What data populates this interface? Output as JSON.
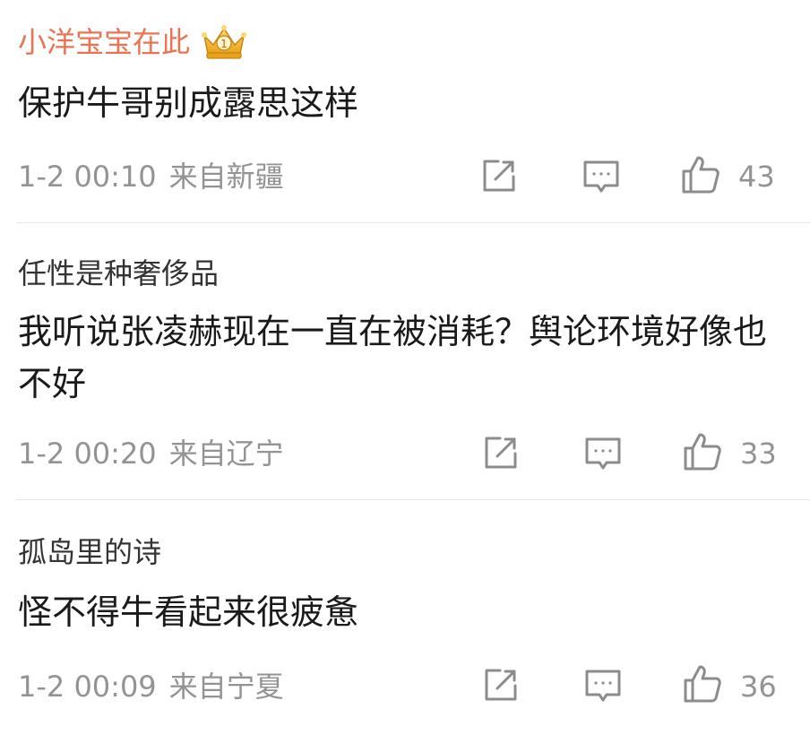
{
  "comments": [
    {
      "username": "小洋宝宝在此",
      "vip_badge_icon": "crown-icon",
      "text": "保护牛哥别成露思这样",
      "time": "1-2 00:10",
      "location": "来自新疆",
      "likes": "43"
    },
    {
      "username": "任性是种奢侈品",
      "text": "我听说张凌赫现在一直在被消耗？舆论环境好像也不好",
      "time": "1-2 00:20",
      "location": "来自辽宁",
      "likes": "33"
    },
    {
      "username": "孤岛里的诗",
      "text": "怪不得牛看起来很疲惫",
      "time": "1-2 00:09",
      "location": "来自宁夏",
      "likes": "36"
    }
  ],
  "colors": {
    "vip_name": "#eb7350",
    "name": "#333333",
    "text": "#1a1a1a",
    "meta": "#939393",
    "icon": "#8c8c8c"
  },
  "icons": [
    "share-icon",
    "comment-icon",
    "like-icon"
  ]
}
